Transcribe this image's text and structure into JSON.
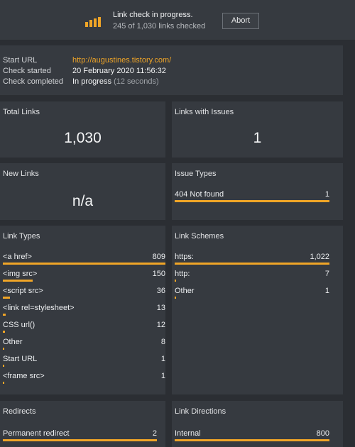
{
  "banner": {
    "title": "Link check in progress.",
    "subtitle": "245 of 1,030 links checked",
    "abort_label": "Abort",
    "progress_icon": "progress-bars-icon",
    "accent": "#f0a527"
  },
  "info": {
    "start_url_label": "Start URL",
    "start_url": "http://augustines.tistory.com/",
    "check_started_label": "Check started",
    "check_started": "20 February 2020 11:56:32",
    "check_completed_label": "Check completed",
    "check_completed": "In progress",
    "check_completed_note": "(12 seconds)"
  },
  "total_links": {
    "title": "Total Links",
    "value": "1,030"
  },
  "links_with_issues": {
    "title": "Links with Issues",
    "value": "1"
  },
  "new_links": {
    "title": "New Links",
    "value": "n/a"
  },
  "issue_types": {
    "title": "Issue Types",
    "items": [
      {
        "name": "404 Not found",
        "count": "1",
        "fraction": 1.0
      }
    ]
  },
  "link_types": {
    "title": "Link Types",
    "items": [
      {
        "name": "<a href>",
        "count": "809",
        "fraction": 1.0
      },
      {
        "name": "<img src>",
        "count": "150",
        "fraction": 0.185
      },
      {
        "name": "<script src>",
        "count": "36",
        "fraction": 0.044
      },
      {
        "name": "<link rel=stylesheet>",
        "count": "13",
        "fraction": 0.016
      },
      {
        "name": "CSS url()",
        "count": "12",
        "fraction": 0.015
      },
      {
        "name": "Other",
        "count": "8",
        "fraction": 0.01
      },
      {
        "name": "Start URL",
        "count": "1",
        "fraction": 0.0012
      },
      {
        "name": "<frame src>",
        "count": "1",
        "fraction": 0.0012
      }
    ]
  },
  "link_schemes": {
    "title": "Link Schemes",
    "items": [
      {
        "name": "https:",
        "count": "1,022",
        "fraction": 1.0
      },
      {
        "name": "http:",
        "count": "7",
        "fraction": 0.007
      },
      {
        "name": "Other",
        "count": "1",
        "fraction": 0.001
      }
    ]
  },
  "redirects": {
    "title": "Redirects",
    "items": [
      {
        "name": "Permanent redirect",
        "count": "2",
        "fraction": 1.0
      }
    ]
  },
  "link_directions": {
    "title": "Link Directions",
    "items": [
      {
        "name": "Internal",
        "count": "800",
        "fraction": 1.0
      }
    ]
  }
}
